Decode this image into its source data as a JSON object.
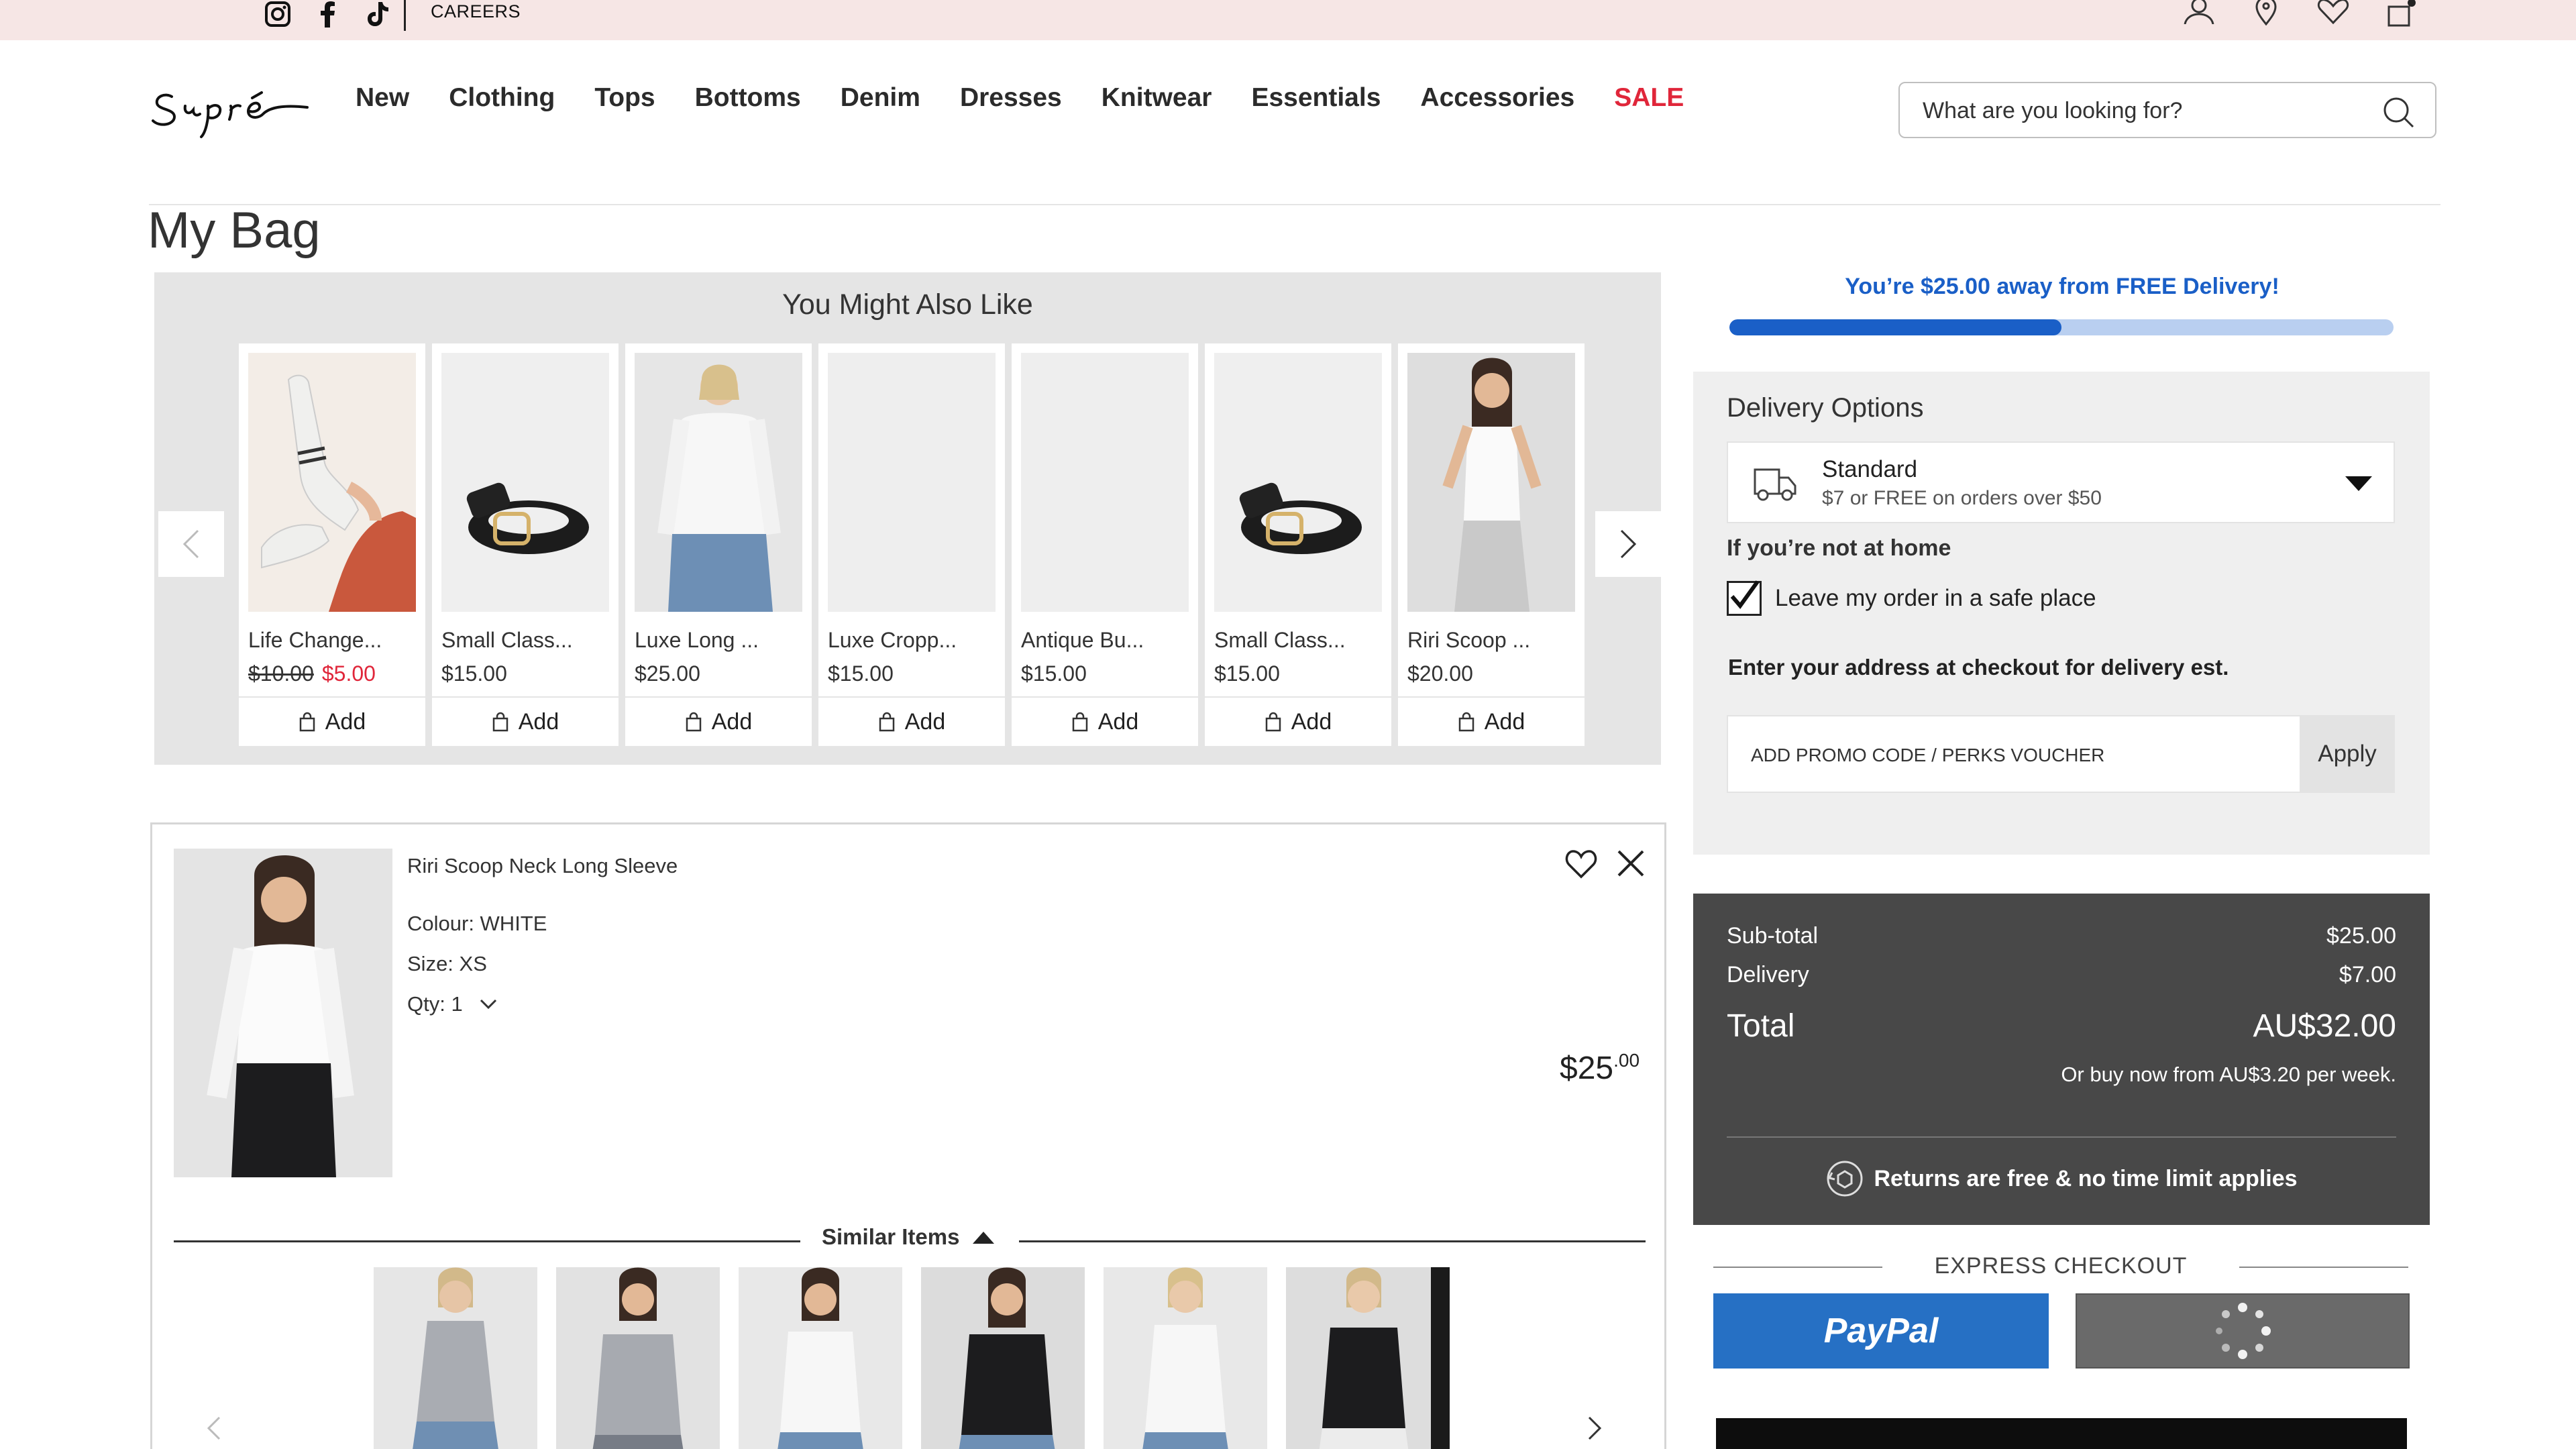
{
  "topbar": {
    "social_icons": [
      "instagram-icon",
      "facebook-icon",
      "tiktok-icon"
    ],
    "careers_label": "CAREERS",
    "account_icons": [
      "user-icon",
      "location-pin-icon",
      "heart-icon",
      "bag-icon"
    ]
  },
  "header": {
    "logo_text": "Supré",
    "nav": [
      "New",
      "Clothing",
      "Tops",
      "Bottoms",
      "Denim",
      "Dresses",
      "Knitwear",
      "Essentials",
      "Accessories",
      "SALE"
    ],
    "search_placeholder": "What are you looking for?"
  },
  "page": {
    "title": "My Bag"
  },
  "recommendations": {
    "title": "You Might Also Like",
    "add_label": "Add",
    "items": [
      {
        "name": "Life Change...",
        "old_price": "$10.00",
        "price": "$5.00"
      },
      {
        "name": "Small Class...",
        "old_price": "",
        "price": "$15.00"
      },
      {
        "name": "Luxe Long ...",
        "old_price": "",
        "price": "$25.00"
      },
      {
        "name": "Luxe Cropp...",
        "old_price": "",
        "price": "$15.00"
      },
      {
        "name": "Antique Bu...",
        "old_price": "",
        "price": "$15.00"
      },
      {
        "name": "Small Class...",
        "old_price": "",
        "price": "$15.00"
      },
      {
        "name": "Riri Scoop ...",
        "old_price": "",
        "price": "$20.00"
      }
    ]
  },
  "bag_item": {
    "name": "Riri Scoop Neck Long Sleeve",
    "colour": "Colour: WHITE",
    "size": "Size: XS",
    "qty_label": "Qty:",
    "qty_value": "1",
    "price_main": "$25",
    "price_cents": ".00",
    "similar_label": "Similar Items"
  },
  "delivery": {
    "free_delivery_text": "You’re $25.00 away from FREE Delivery!",
    "progress_fraction": 0.5,
    "title": "Delivery Options",
    "option_name": "Standard",
    "option_desc": "$7 or FREE on orders over $50",
    "away_label": "If you’re not at home",
    "safe_place_label": "Leave my order in a safe place",
    "safe_place_checked": true,
    "address_note": "Enter your address at checkout for delivery est.",
    "promo_placeholder": "ADD PROMO CODE / PERKS VOUCHER",
    "apply_label": "Apply"
  },
  "summary": {
    "subtotal_label": "Sub-total",
    "subtotal_value": "$25.00",
    "delivery_label": "Delivery",
    "delivery_value": "$7.00",
    "total_label": "Total",
    "total_value": "AU$32.00",
    "weekly_text": "Or buy now from AU$3.20 per week.",
    "returns_text": "Returns are free & no time limit applies"
  },
  "express": {
    "label": "EXPRESS CHECKOUT",
    "paypal_label": "PayPal"
  },
  "colors": {
    "topbar_bg": "#f6e6e5",
    "sale": "#e0263a",
    "accent_blue": "#1a5fc7",
    "paypal_blue": "#2670c4",
    "summary_bg": "#484848"
  }
}
